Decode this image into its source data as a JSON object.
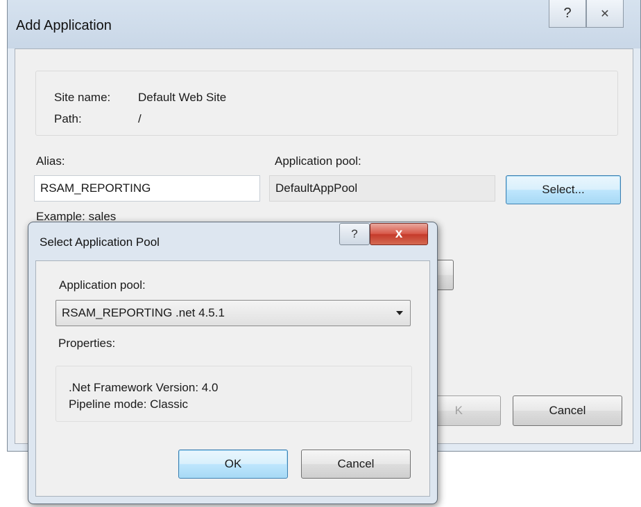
{
  "add_application": {
    "title": "Add Application",
    "help_glyph": "?",
    "close_glyph": "✕",
    "site_name_label": "Site name:",
    "site_name_value": "Default Web Site",
    "path_label": "Path:",
    "path_value": "/",
    "alias_label": "Alias:",
    "alias_value": "RSAM_REPORTING",
    "app_pool_label": "Application pool:",
    "app_pool_value": "DefaultAppPool",
    "select_button": "Select...",
    "example_text": "Example: sales",
    "ok_button_partial": "K",
    "cancel_button": "Cancel"
  },
  "select_pool_dialog": {
    "title": "Select Application Pool",
    "help_glyph": "?",
    "close_glyph": "x",
    "app_pool_label": "Application pool:",
    "app_pool_selected": "RSAM_REPORTING .net 4.5.1",
    "properties_label": "Properties:",
    "net_version": ".Net Framework Version: 4.0",
    "pipeline_mode": "Pipeline mode: Classic",
    "ok_button": "OK",
    "cancel_button": "Cancel"
  }
}
